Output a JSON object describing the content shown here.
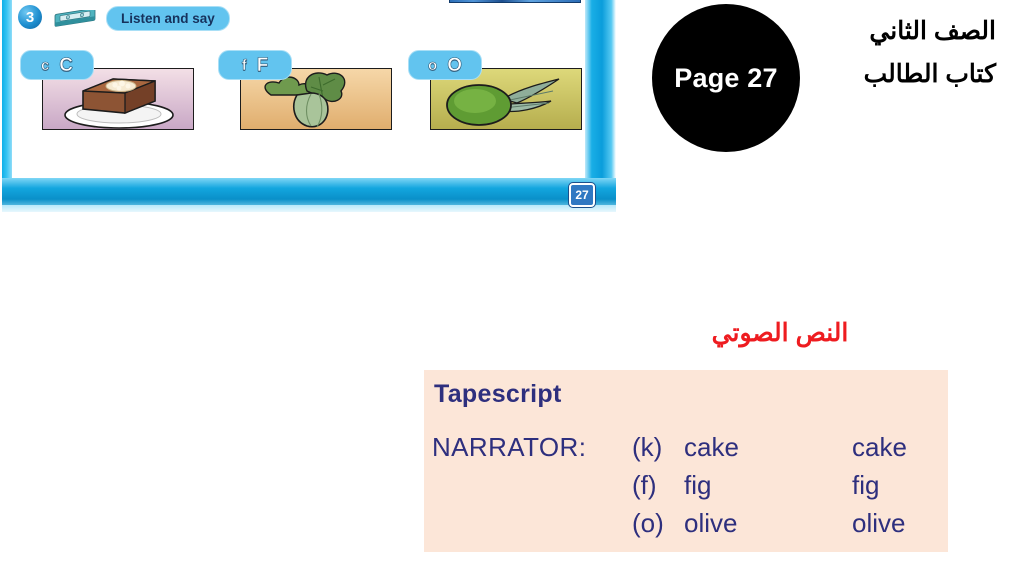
{
  "header": {
    "page_circle_label": "Page 27",
    "arabic_line1": "الصف الثاني",
    "arabic_line2": "كتاب الطالب",
    "circle_color": "#000000"
  },
  "worksheet": {
    "exercise_number": "3",
    "instruction_pill": "Listen and say",
    "cassette_icon": "cassette-tape-icon",
    "page_number_badge": "27",
    "accent_color": "#62c4ef",
    "panels": [
      {
        "lower": "c",
        "upper": "C",
        "picture": "cake",
        "bg": "#c9a8c6"
      },
      {
        "lower": "f",
        "upper": "F",
        "picture": "fig",
        "bg": "#e0ae6e"
      },
      {
        "lower": "o",
        "upper": "O",
        "picture": "olive",
        "bg": "#b6ae4e"
      }
    ]
  },
  "tapescript": {
    "heading_arabic": "النص الصوتي",
    "heading_color": "#ee1c20",
    "box_color": "#fce6d8",
    "text_color": "#2e2f7e",
    "title": "Tapescript",
    "speaker": "NARRATOR:",
    "rows": [
      {
        "tag": "(k)",
        "word": "cake",
        "repeat": "cake"
      },
      {
        "tag": "(f)",
        "word": "fig",
        "repeat": "fig"
      },
      {
        "tag": "(o)",
        "word": "olive",
        "repeat": "olive"
      }
    ]
  }
}
